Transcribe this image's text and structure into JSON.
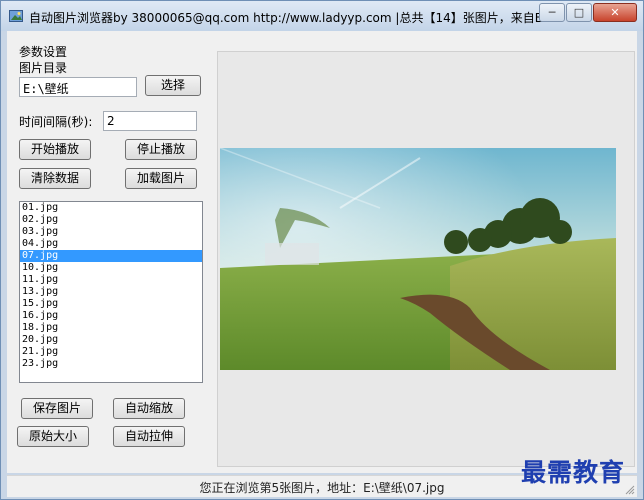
{
  "window": {
    "title": "自动图片浏览器by 38000065@qq.com http://www.ladyyp.com |总共【14】张图片，来自E:...",
    "minimize_glyph": "─",
    "maximize_glyph": "□",
    "close_glyph": "✕"
  },
  "settings": {
    "group_title": "参数设置",
    "dir_label": "图片目录",
    "dir_value": "E:\\壁纸",
    "choose_button": "选择",
    "interval_label": "时间间隔(秒):",
    "interval_value": "2",
    "start_button": "开始播放",
    "stop_button": "停止播放",
    "clear_button": "清除数据",
    "load_button": "加载图片"
  },
  "file_list": {
    "items": [
      "01.jpg",
      "02.jpg",
      "03.jpg",
      "04.jpg",
      "07.jpg",
      "10.jpg",
      "11.jpg",
      "13.jpg",
      "15.jpg",
      "16.jpg",
      "18.jpg",
      "20.jpg",
      "21.jpg",
      "23.jpg"
    ],
    "selected_index": 4
  },
  "actions": {
    "save_button": "保存图片",
    "auto_zoom_button": "自动缩放",
    "original_size_button": "原始大小",
    "auto_stretch_button": "自动拉伸"
  },
  "status": {
    "text": "您正在浏览第5张图片，地址：E:\\壁纸\\07.jpg"
  },
  "watermark": {
    "text": "最需教育"
  },
  "colors": {
    "selection": "#3399ff",
    "watermark": "#1f3fb0"
  }
}
